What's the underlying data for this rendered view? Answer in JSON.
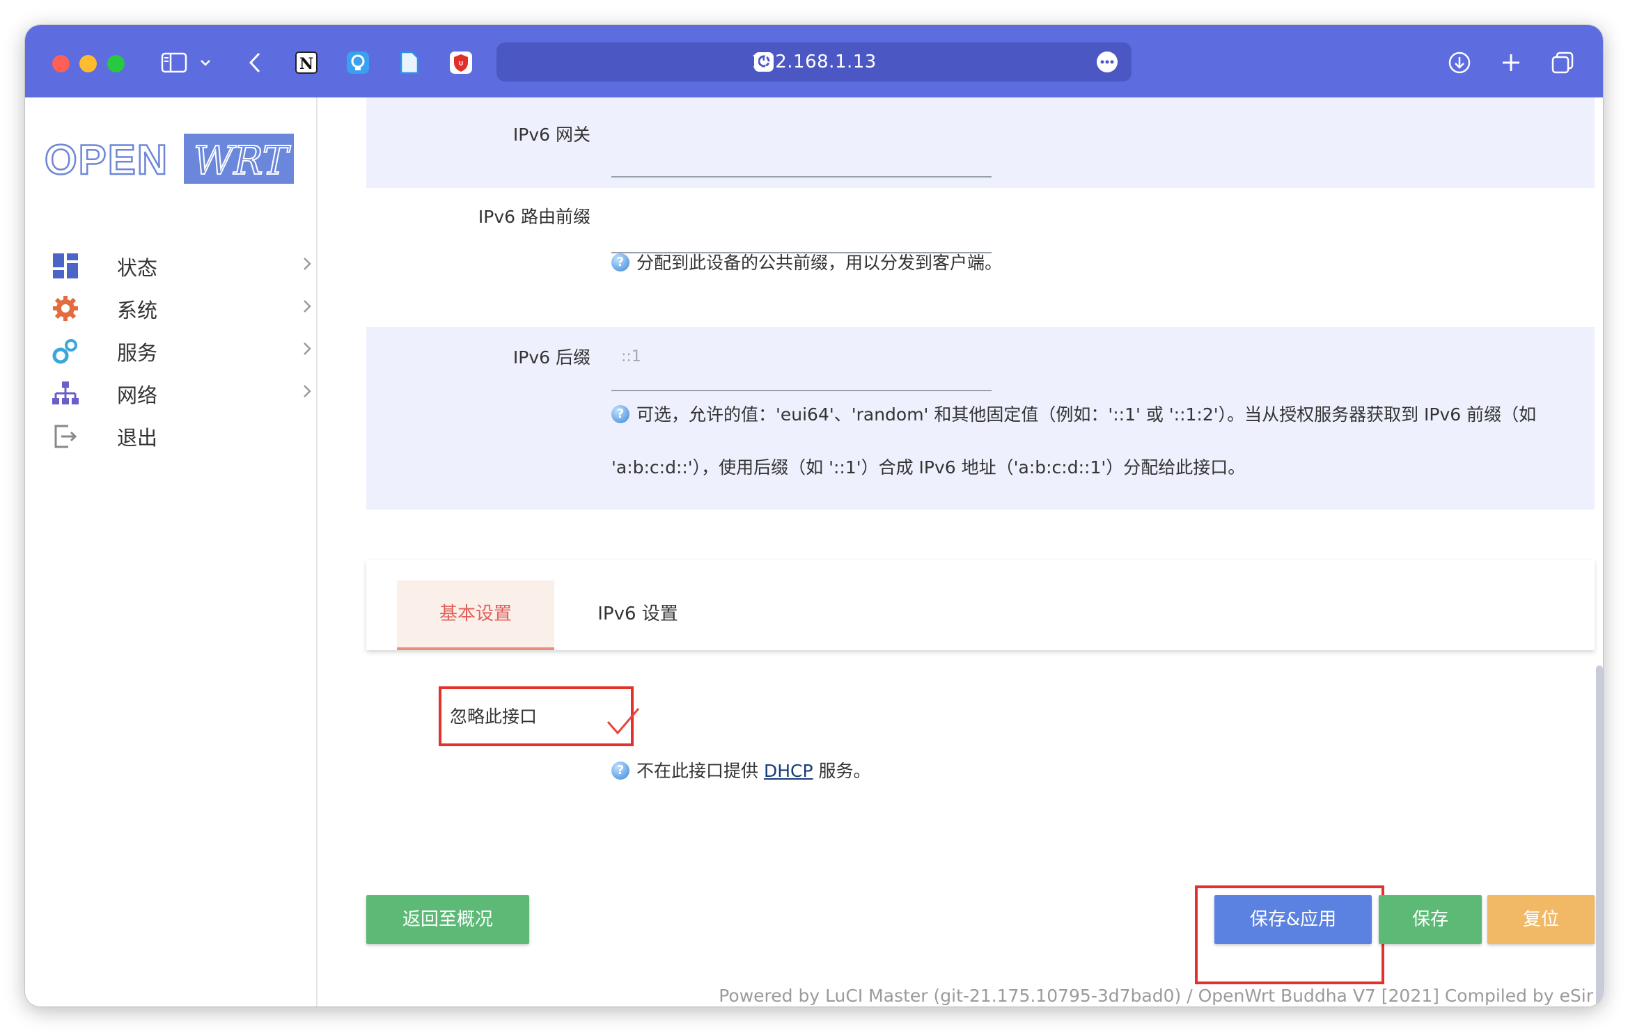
{
  "browser": {
    "url": "192.168.1.13"
  },
  "sidebar": {
    "logo_text_left": "OPEN",
    "logo_text_right": "WRT",
    "items": [
      {
        "label": "状态",
        "icon": "dashboard-icon"
      },
      {
        "label": "系统",
        "icon": "gear-icon"
      },
      {
        "label": "服务",
        "icon": "gears-icon"
      },
      {
        "label": "网络",
        "icon": "network-icon"
      },
      {
        "label": "退出",
        "icon": "logout-icon"
      }
    ]
  },
  "form": {
    "ipv6_gateway_label": "IPv6 网关",
    "ipv6_prefix_label": "IPv6 路由前缀",
    "ipv6_prefix_hint": "分配到此设备的公共前缀，用以分发到客户端。",
    "ipv6_suffix_label": "IPv6 后缀",
    "ipv6_suffix_placeholder": "::1",
    "ipv6_suffix_hint_line1": "可选，允许的值：'eui64'、'random' 和其他固定值（例如：'::1' 或 '::1:2'）。当从授权服务器获取到 IPv6 前缀（如",
    "ipv6_suffix_hint_line2": "'a:b:c:d::'），使用后缀（如 '::1'）合成 IPv6 地址（'a:b:c:d::1'）分配给此接口。"
  },
  "tabs": {
    "basic": "基本设置",
    "ipv6": "IPv6 设置"
  },
  "ignore": {
    "label": "忽略此接口",
    "checked": true,
    "hint_before": "不在此接口提供",
    "hint_link": "DHCP",
    "hint_after": "服务。"
  },
  "buttons": {
    "back": "返回至概况",
    "save_apply": "保存&应用",
    "save": "保存",
    "reset": "复位"
  },
  "colors": {
    "titlebar": "#5d6de0",
    "btn_green": "#5cb976",
    "btn_blue": "#5b82e0",
    "btn_orange": "#f1b865",
    "highlight_red": "#e2322b"
  },
  "footer": "Powered by LuCI Master (git-21.175.10795-3d7bad0) / OpenWrt Buddha V7 [2021] Compiled by eSir"
}
